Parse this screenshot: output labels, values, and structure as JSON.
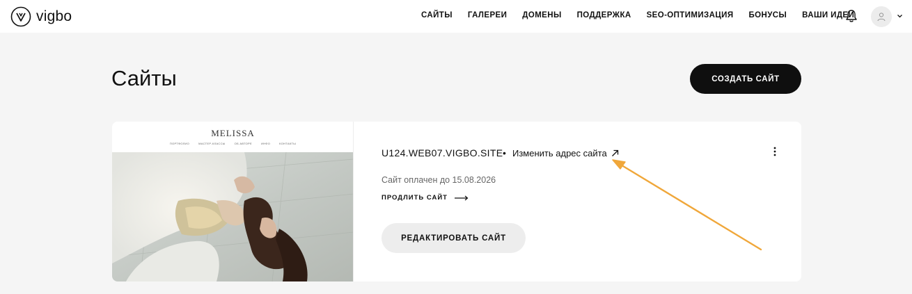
{
  "header": {
    "logo_text": "vigbo",
    "nav": [
      "САЙТЫ",
      "ГАЛЕРЕИ",
      "ДОМЕНЫ",
      "ПОДДЕРЖКА",
      "SEO-ОПТИМИЗАЦИЯ",
      "БОНУСЫ",
      "ВАШИ ИДЕИ"
    ],
    "icons": [
      "vigbo-logo-icon",
      "bell-icon",
      "user-icon",
      "chevron-down-icon"
    ]
  },
  "page": {
    "title": "Сайты",
    "create_button": "СОЗДАТЬ САЙТ"
  },
  "site": {
    "preview": {
      "brand": "MELISSA",
      "menu": [
        "ПОРТФОЛИО",
        "МАСТЕР-КЛАССЫ",
        "ОБ АВТОРЕ",
        "ИНФО",
        "КОНТАКТЫ"
      ]
    },
    "domain": "U124.WEB07.VIGBO.SITE",
    "separator": "•",
    "change_address_label": "Изменить адрес сайта",
    "paid_until": "Сайт оплачен до 15.08.2026",
    "extend_label": "ПРОДЛИТЬ САЙТ",
    "edit_button": "РЕДАКТИРОВАТЬ САЙТ",
    "icons": [
      "arrow-up-right-icon",
      "more-vertical-icon",
      "arrow-right-icon"
    ]
  },
  "annotation": {
    "color": "#f0a73a",
    "icon": "annotation-arrow"
  }
}
